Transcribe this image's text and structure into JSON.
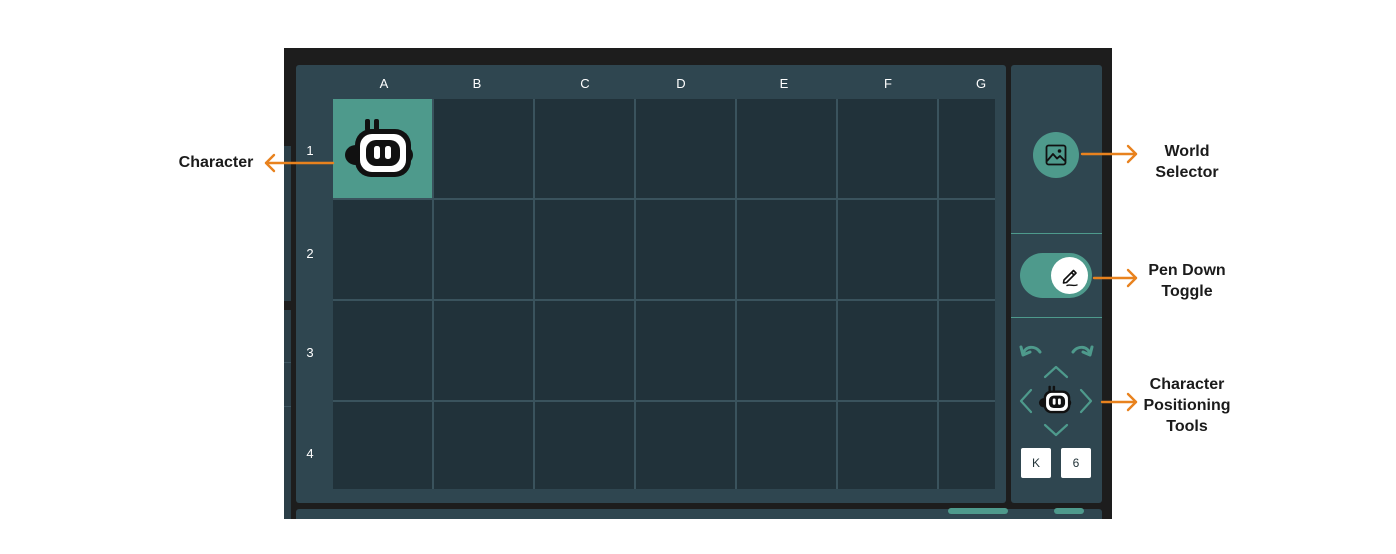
{
  "grid": {
    "columns": [
      "A",
      "B",
      "C",
      "D",
      "E",
      "F",
      "G"
    ],
    "rows": [
      "1",
      "2",
      "3",
      "4"
    ],
    "character_cell": "A1"
  },
  "sidebar": {
    "world_selector_icon": "image-icon",
    "pen_toggle_icon": "pencil-icon",
    "pen_down": true,
    "undo_icon": "undo-icon",
    "redo_icon": "redo-icon",
    "coordinates": {
      "column": "K",
      "row": "6"
    }
  },
  "annotations": {
    "character": "Character",
    "world_selector": [
      "World",
      "Selector"
    ],
    "pen_down_toggle": [
      "Pen Down",
      "Toggle"
    ],
    "positioning_tools": [
      "Character",
      "Positioning",
      "Tools"
    ]
  },
  "colors": {
    "accent": "#4e9a8c",
    "panel": "#2f4650",
    "cell": "#21323a",
    "arrow": "#e8821e"
  }
}
